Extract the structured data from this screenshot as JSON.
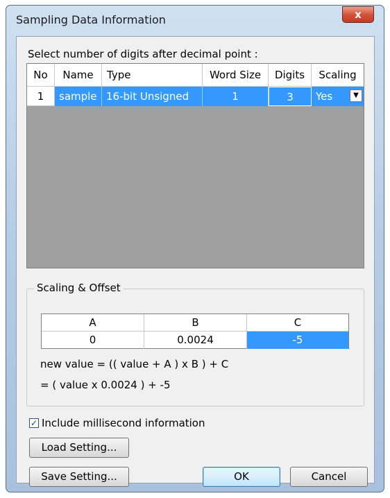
{
  "window": {
    "title": "Sampling Data Information",
    "close_label": "x"
  },
  "instruction": "Select number of digits after decimal point :",
  "table": {
    "headers": [
      "No",
      "Name",
      "Type",
      "Word Size",
      "Digits",
      "Scaling"
    ],
    "row": {
      "no": "1",
      "name": "sample",
      "type": "16-bit Unsigned",
      "word_size": "1",
      "digits": "3",
      "scaling": "Yes"
    },
    "dropdown_icon": "▼"
  },
  "scaling": {
    "group_label": "Scaling & Offset",
    "headers": [
      "A",
      "B",
      "C"
    ],
    "values": [
      "0",
      "0.0024",
      "-5"
    ],
    "formula_line1": "new value = (( value + A ) x B ) + C",
    "formula_line2": "= ( value x 0.0024 ) + -5"
  },
  "checkbox": {
    "label": "Include millisecond information",
    "checked": true,
    "mark": "✓"
  },
  "buttons": {
    "load": "Load Setting...",
    "save": "Save Setting...",
    "ok": "OK",
    "cancel": "Cancel"
  },
  "colors": {
    "selection": "#3399ff",
    "grid_empty": "#a0a0a0"
  }
}
